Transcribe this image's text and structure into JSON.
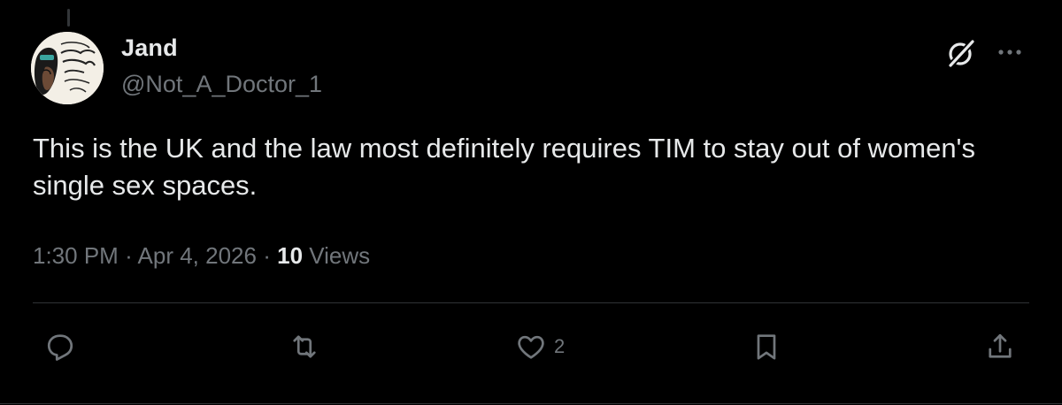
{
  "author": {
    "name": "Jand",
    "handle": "@Not_A_Doctor_1",
    "avatar_text": "woman strong queen"
  },
  "tweet": {
    "text": "This is the UK and the law most definitely requires TIM to stay out of women's single sex spaces."
  },
  "meta": {
    "time": "1:30 PM",
    "separator": "·",
    "date": "Apr 4, 2026",
    "views_count": "10",
    "views_label": "Views"
  },
  "actions": {
    "reply_icon": "reply-icon",
    "retweet_icon": "retweet-icon",
    "like_icon": "heart-icon",
    "like_count": "2",
    "bookmark_icon": "bookmark-icon",
    "share_icon": "share-icon"
  },
  "header_icons": {
    "grok": "grok-icon",
    "more": "more-icon"
  },
  "colors": {
    "background": "#000000",
    "primary_text": "#e7e9ea",
    "secondary_text": "#71767b",
    "divider": "#2f3336"
  }
}
